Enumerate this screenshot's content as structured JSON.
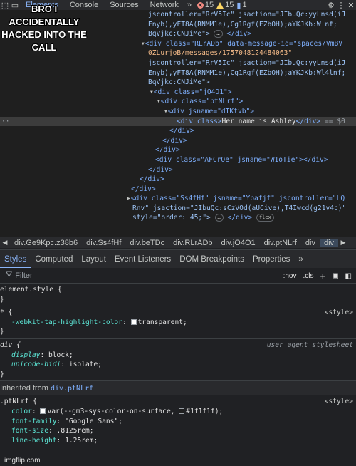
{
  "meme": {
    "caption": "BRO I ACCIDENTALLY HACKED INTO THE CALL",
    "watermark": "imgflip.com"
  },
  "toolbar": {
    "tabs": [
      "Elements",
      "Console",
      "Sources",
      "Network"
    ],
    "active_tab": "Elements",
    "error_count": "15",
    "warning_count": "15",
    "info_count": "1"
  },
  "dom": {
    "line1": "jscontroller=\"RrV5Ic\" jsaction=\"JIbuQc:yyLnsd(iJ",
    "line2": "Enyb),yFT8A(RNMM1e),Cg1Rgf(EZbOH);aYKJKb:W",
    "line2_end": "nf;",
    "line3": "BqVjkc:CNJiMe\">",
    "line3_end": "</div>",
    "line4_tag": "<div class=\"RLrADb\" data-message-id=\"spaces/VmBV",
    "line5": "0ZLurjoB/messages/1757048124484063\"",
    "line6": "jscontroller=\"RrV5Ic\" jsaction=\"JIbuQc:yyLnsd(iJ",
    "line7": "Enyb),yFT8A(RNMM1e),Cg1Rgf(EZbOH);aYKJKb:Wl4lnf;",
    "line8": "BqVjkc:CNJiMe\">",
    "line9": "<div class=\"jO4O1\">",
    "line10": "<div class=\"ptNLrf\">",
    "line11": "<div jsname=\"dTKtvb\">",
    "line12_tag_open": "<div class>",
    "line12_text": "Her name is Ashley",
    "line12_tag_close": "</div>",
    "line12_suffix": "== $0",
    "line13": "</div>",
    "line14": "</div>",
    "line15": "</div>",
    "line16": "<div class=\"AFCrOe\" jsname=\"W1oTie\"></div>",
    "line17": "</div>",
    "line18": "</div>",
    "line19": "</div>",
    "line20": "<div class=\"Ss4fHf\" jsname=\"Ypafjf\" jscontroller=\"LQ",
    "line21": "Rnv\" jsaction=\"JIbuQc:sCzVOd(aUCive),T4Iwcd(g21v4c)\"",
    "line22": "style=\"order: 45;\">",
    "line22_end": "</div>",
    "flex_badge": "flex",
    "ellipsis": "…",
    "ellipsis_dots": "··"
  },
  "breadcrumbs": [
    "div.Ge9Kpc.z38b6",
    "div.Ss4fHf",
    "div.beTDc",
    "div.RLrADb",
    "div.jO4O1",
    "div.ptNLrf",
    "div",
    "div"
  ],
  "styles_tabs": [
    "Styles",
    "Computed",
    "Layout",
    "Event Listeners",
    "DOM Breakpoints",
    "Properties"
  ],
  "filter": {
    "placeholder": "Filter",
    "hov": ":hov",
    "cls": ".cls"
  },
  "styles": {
    "element_style": "element.style {",
    "close": "}",
    "star_selector": "* {",
    "star_source": "<style>",
    "star_prop": "-webkit-tap-highlight-color",
    "star_value": "transparent;",
    "div_selector": "div {",
    "div_source": "user agent stylesheet",
    "div_prop1": "display",
    "div_val1": "block;",
    "div_prop2": "unicode-bidi",
    "div_val2": "isolate;",
    "inherited_label": "Inherited from",
    "inherited_class": "div.ptNLrf",
    "ptn_selector": ".ptNLrf {",
    "ptn_source": "<style>",
    "ptn_color_prop": "color",
    "ptn_color_val": "var(--gm3-sys-color-on-surface,",
    "ptn_color_fallback": "#1f1f1f);",
    "ptn_font_prop": "font-family",
    "ptn_font_val": "\"Google Sans\";",
    "ptn_size_prop": "font-size",
    "ptn_size_val": ".8125rem;",
    "ptn_lh_prop": "line-height",
    "ptn_lh_val": "1.25rem;"
  },
  "colors": {
    "background": "#202124",
    "tag": "#7cacf8",
    "attr_value": "#f8bd8a",
    "property": "#5ce5d5",
    "accent": "#8ab4f8"
  }
}
